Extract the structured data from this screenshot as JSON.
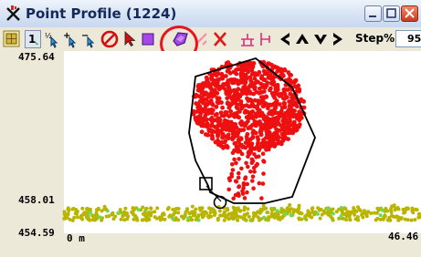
{
  "window": {
    "title": "Point Profile (1224)",
    "icons": {
      "app": "point-profile-app-icon",
      "min": "minimize-icon",
      "max": "maximize-icon",
      "close": "close-icon"
    }
  },
  "toolbar": {
    "tools": [
      {
        "name": "select-layers-icon"
      },
      {
        "name": "point-1-icon"
      },
      {
        "name": "point-select-half-icon"
      },
      {
        "name": "point-add-icon"
      },
      {
        "name": "point-remove-icon"
      },
      {
        "name": "no-selection-icon"
      },
      {
        "name": "arrow-select-icon"
      },
      {
        "name": "rectangle-select-icon"
      },
      {
        "name": "polygon-select-icon"
      },
      {
        "name": "line-draw-icon"
      },
      {
        "name": "delete-x-icon"
      },
      {
        "name": "elevation-align-icon"
      },
      {
        "name": "profile-split-icon"
      },
      {
        "name": "pan-left-icon"
      },
      {
        "name": "pan-up-icon"
      },
      {
        "name": "pan-down-icon"
      },
      {
        "name": "pan-right-icon"
      }
    ],
    "step_label": "Step%",
    "step_value": "95"
  },
  "profile": {
    "y_top_label": "475.64",
    "y_mid_label": "458.01",
    "y_bottom_label": "454.59",
    "x_left_label": "0 m",
    "x_right_label": "46.46",
    "colors": {
      "tree_points": "#ee1010",
      "ground_points": "#b8b400",
      "green_points": "#5ee05e",
      "polygon": "#000000",
      "background": "#ffffff"
    }
  }
}
